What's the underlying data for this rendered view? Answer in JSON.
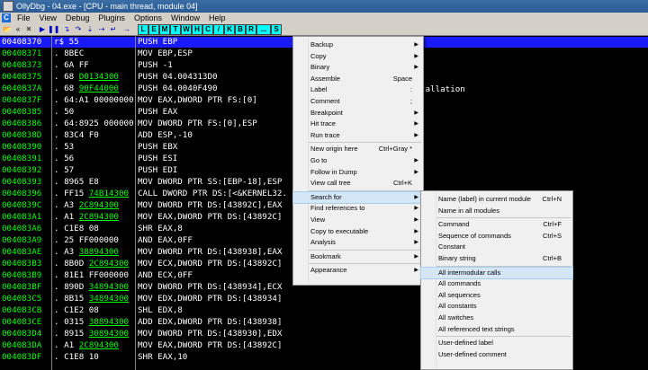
{
  "window": {
    "title": "OllyDbg - 04.exe - [CPU - main thread, module 04]"
  },
  "menu": [
    "File",
    "View",
    "Debug",
    "Plugins",
    "Options",
    "Window",
    "Help"
  ],
  "toolbar": {
    "icons": [
      "open-icon",
      "restart-icon",
      "close-icon",
      "run-icon",
      "pause-icon",
      "step-into-icon",
      "step-over-icon",
      "trace-into-icon",
      "trace-over-icon",
      "execute-till-return-icon",
      "goto-icon"
    ],
    "letters": [
      "L",
      "E",
      "M",
      "T",
      "W",
      "H",
      "C",
      "/",
      "K",
      "B",
      "R",
      "...",
      "S"
    ]
  },
  "rows": [
    {
      "addr": "00408370",
      "mark": "r$",
      "hex": "55",
      "hexu": "",
      "asm": "PUSH EBP",
      "sel": true
    },
    {
      "addr": "00408371",
      "mark": ".",
      "hex": "8BEC",
      "hexu": "",
      "asm": "MOV EBP,ESP"
    },
    {
      "addr": "00408373",
      "mark": ".",
      "hex": "6A FF",
      "hexu": "",
      "asm": "PUSH -1"
    },
    {
      "addr": "00408375",
      "mark": ".",
      "hex": "68 ",
      "hexu": "D0134300",
      "asm": "PUSH 04.004313D0"
    },
    {
      "addr": "0040837A",
      "mark": ".",
      "hex": "68 ",
      "hexu": "90F44000",
      "asm": "PUSH 04.0040F490"
    },
    {
      "addr": "0040837F",
      "mark": ".",
      "hex": "64:A1 00000000",
      "hexu": "",
      "asm": "MOV EAX,DWORD PTR FS:[0]"
    },
    {
      "addr": "00408385",
      "mark": ".",
      "hex": "50",
      "hexu": "",
      "asm": "PUSH EAX"
    },
    {
      "addr": "00408386",
      "mark": ".",
      "hex": "64:8925 000000",
      "hexu": "",
      "asm": "MOV DWORD PTR FS:[0],ESP"
    },
    {
      "addr": "0040838D",
      "mark": ".",
      "hex": "83C4 F0",
      "hexu": "",
      "asm": "ADD ESP,-10"
    },
    {
      "addr": "00408390",
      "mark": ".",
      "hex": "53",
      "hexu": "",
      "asm": "PUSH EBX"
    },
    {
      "addr": "00408391",
      "mark": ".",
      "hex": "56",
      "hexu": "",
      "asm": "PUSH ESI"
    },
    {
      "addr": "00408392",
      "mark": ".",
      "hex": "57",
      "hexu": "",
      "asm": "PUSH EDI"
    },
    {
      "addr": "00408393",
      "mark": ".",
      "hex": "8965 E8",
      "hexu": "",
      "asm": "MOV DWORD PTR SS:[EBP-18],ESP"
    },
    {
      "addr": "00408396",
      "mark": ".",
      "hex": "FF15 ",
      "hexu": "74B14300",
      "asm": "CALL DWORD PTR DS:[<&KERNEL32."
    },
    {
      "addr": "0040839C",
      "mark": ".",
      "hex": "A3 ",
      "hexu": "2C894300",
      "asm": "MOV DWORD PTR DS:[43892C],EAX"
    },
    {
      "addr": "004083A1",
      "mark": ".",
      "hex": "A1 ",
      "hexu": "2C894300",
      "asm": "MOV EAX,DWORD PTR DS:[43892C]"
    },
    {
      "addr": "004083A6",
      "mark": ".",
      "hex": "C1E8 08",
      "hexu": "",
      "asm": "SHR EAX,8"
    },
    {
      "addr": "004083A9",
      "mark": ".",
      "hex": "25 FF000000",
      "hexu": "",
      "asm": "AND EAX,0FF"
    },
    {
      "addr": "004083AE",
      "mark": ".",
      "hex": "A3 ",
      "hexu": "38894300",
      "asm": "MOV DWORD PTR DS:[438938],EAX"
    },
    {
      "addr": "004083B3",
      "mark": ".",
      "hex": "8B0D ",
      "hexu": "2C894300",
      "asm": "MOV ECX,DWORD PTR DS:[43892C]"
    },
    {
      "addr": "004083B9",
      "mark": ".",
      "hex": "81E1 FF000000",
      "hexu": "",
      "asm": "AND ECX,0FF"
    },
    {
      "addr": "004083BF",
      "mark": ".",
      "hex": "890D ",
      "hexu": "34894300",
      "asm": "MOV DWORD PTR DS:[438934],ECX"
    },
    {
      "addr": "004083C5",
      "mark": ".",
      "hex": "8B15 ",
      "hexu": "34894300",
      "asm": "MOV EDX,DWORD PTR DS:[438934]"
    },
    {
      "addr": "004083CB",
      "mark": ".",
      "hex": "C1E2 08",
      "hexu": "",
      "asm": "SHL EDX,8"
    },
    {
      "addr": "004083CE",
      "mark": ".",
      "hex": "0315 ",
      "hexu": "38894300",
      "asm": "ADD EDX,DWORD PTR DS:[438938]"
    },
    {
      "addr": "004083D4",
      "mark": ".",
      "hex": "8915 ",
      "hexu": "30894300",
      "asm": "MOV DWORD PTR DS:[438930],EDX"
    },
    {
      "addr": "004083DA",
      "mark": ".",
      "hex": "A1 ",
      "hexu": "2C894300",
      "asm": "MOV EAX,DWORD PTR DS:[43892C]"
    },
    {
      "addr": "004083DF",
      "mark": ".",
      "hex": "C1E8 10",
      "hexu": "",
      "asm": "SHR EAX,10"
    }
  ],
  "background_text": "tallation",
  "context_menu": [
    {
      "label": "Backup",
      "shortcut": "",
      "arrow": true
    },
    {
      "label": "Copy",
      "shortcut": "",
      "arrow": true
    },
    {
      "label": "Binary",
      "shortcut": "",
      "arrow": true
    },
    {
      "label": "Assemble",
      "shortcut": "Space",
      "arrow": false
    },
    {
      "label": "Label",
      "shortcut": ":",
      "arrow": false
    },
    {
      "label": "Comment",
      "shortcut": ";",
      "arrow": false
    },
    {
      "label": "Breakpoint",
      "shortcut": "",
      "arrow": true
    },
    {
      "label": "Hit trace",
      "shortcut": "",
      "arrow": true
    },
    {
      "label": "Run trace",
      "shortcut": "",
      "arrow": true
    },
    {
      "sep": true
    },
    {
      "label": "New origin here",
      "shortcut": "Ctrl+Gray *",
      "arrow": false
    },
    {
      "label": "Go to",
      "shortcut": "",
      "arrow": true
    },
    {
      "label": "Follow in Dump",
      "shortcut": "",
      "arrow": true
    },
    {
      "label": "View call tree",
      "shortcut": "Ctrl+K",
      "arrow": false
    },
    {
      "sep": true
    },
    {
      "label": "Search for",
      "shortcut": "",
      "arrow": true,
      "hl": true
    },
    {
      "label": "Find references to",
      "shortcut": "",
      "arrow": true
    },
    {
      "label": "View",
      "shortcut": "",
      "arrow": true
    },
    {
      "label": "Copy to executable",
      "shortcut": "",
      "arrow": true
    },
    {
      "label": "Analysis",
      "shortcut": "",
      "arrow": true
    },
    {
      "sep": true
    },
    {
      "label": "Bookmark",
      "shortcut": "",
      "arrow": true
    },
    {
      "sep": true
    },
    {
      "label": "Appearance",
      "shortcut": "",
      "arrow": true
    }
  ],
  "submenu": [
    {
      "label": "Name (label) in current module",
      "shortcut": "Ctrl+N"
    },
    {
      "label": "Name in all modules",
      "shortcut": ""
    },
    {
      "sep": true
    },
    {
      "label": "Command",
      "shortcut": "Ctrl+F"
    },
    {
      "label": "Sequence of commands",
      "shortcut": "Ctrl+S"
    },
    {
      "label": "Constant",
      "shortcut": ""
    },
    {
      "label": "Binary string",
      "shortcut": "Ctrl+B"
    },
    {
      "sep": true
    },
    {
      "label": "All intermodular calls",
      "shortcut": "",
      "hl": true
    },
    {
      "label": "All commands",
      "shortcut": ""
    },
    {
      "label": "All sequences",
      "shortcut": ""
    },
    {
      "label": "All constants",
      "shortcut": ""
    },
    {
      "label": "All switches",
      "shortcut": ""
    },
    {
      "label": "All referenced text strings",
      "shortcut": ""
    },
    {
      "sep": true
    },
    {
      "label": "User-defined label",
      "shortcut": ""
    },
    {
      "label": "User-defined comment",
      "shortcut": ""
    }
  ]
}
